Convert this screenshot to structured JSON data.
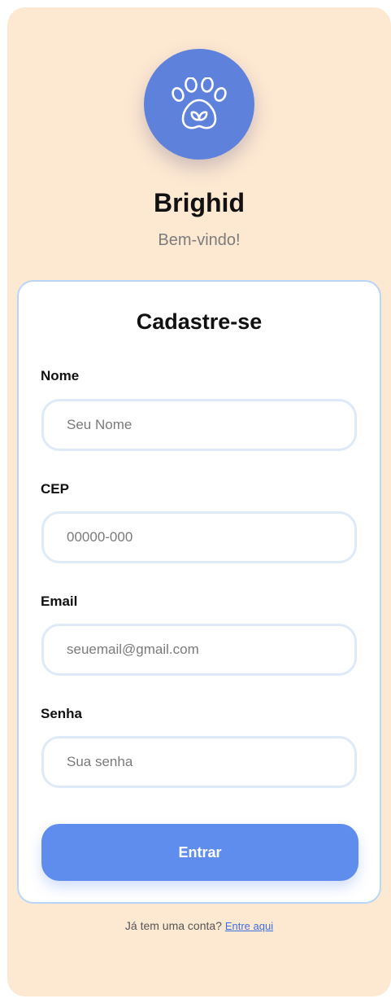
{
  "brand": {
    "name": "Brighid",
    "tagline": "Bem-vindo!",
    "logo_icon": "paw-heart-icon",
    "accent": "#5e82dc"
  },
  "form": {
    "title": "Cadastre-se",
    "fields": [
      {
        "label": "Nome",
        "placeholder": "Seu Nome",
        "value": ""
      },
      {
        "label": "CEP",
        "placeholder": "00000-000",
        "value": ""
      },
      {
        "label": "Email",
        "placeholder": "seuemail@gmail.com",
        "value": ""
      },
      {
        "label": "Senha",
        "placeholder": "Sua senha",
        "value": ""
      }
    ],
    "submit_label": "Entrar",
    "submit_color": "#5f8ded"
  },
  "footer": {
    "prompt": "Já tem uma conta?",
    "link_label": "Entre aqui"
  }
}
